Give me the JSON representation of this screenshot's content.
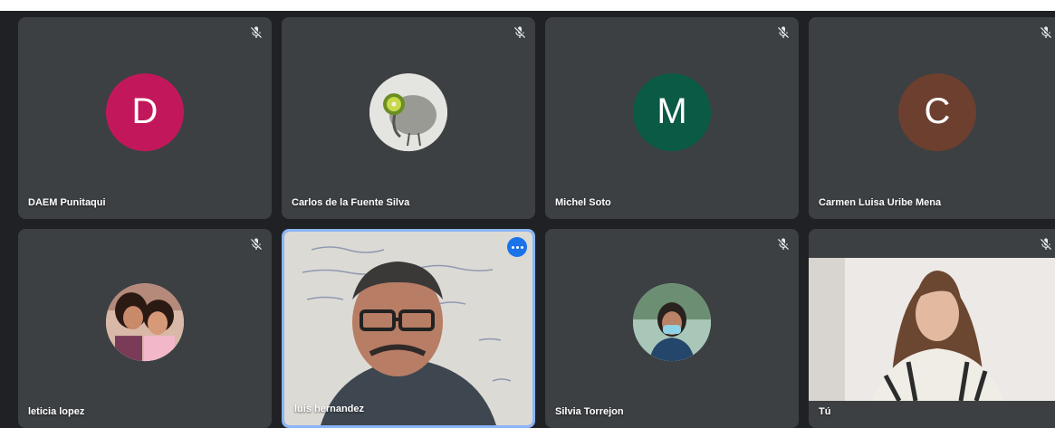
{
  "participants": [
    {
      "name": "DAEM Punitaqui",
      "initial": "D",
      "avatar_color": "#c2185b",
      "muted": true
    },
    {
      "name": "Carlos de la Fuente Silva",
      "avatar_image": "kiwi-bird-drawing",
      "muted": true
    },
    {
      "name": "Michel Soto",
      "initial": "M",
      "avatar_color": "#0b5a46",
      "muted": true
    },
    {
      "name": "Carmen Luisa Uribe Mena",
      "initial": "C",
      "avatar_color": "#6d3f2f",
      "muted": true
    },
    {
      "name": "leticia lopez",
      "avatar_image": "mother-and-daughter-photo",
      "muted": true
    },
    {
      "name": "luis hernandez",
      "video": "man-with-glasses-whiteboard",
      "active_speaker": true
    },
    {
      "name": "Silvia Torrejon",
      "avatar_image": "woman-with-mask-photo",
      "muted": true
    },
    {
      "name": "Tú",
      "video": "young-woman-long-hair",
      "muted": true
    }
  ],
  "colors": {
    "background": "#202124",
    "tile": "#3c4043",
    "active_border": "#8ab4f8",
    "more_button": "#1a73e8"
  }
}
